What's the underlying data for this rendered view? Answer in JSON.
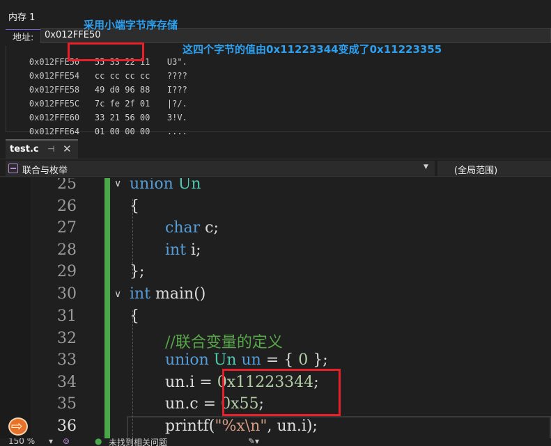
{
  "memory": {
    "title": "内存 1",
    "address_label": "地址:",
    "address_value": "0x012FFE50",
    "rows": [
      {
        "addr": "0x012FFE50",
        "hex": "55 33 22 11",
        "text": "U3\"."
      },
      {
        "addr": "0x012FFE54",
        "hex": "cc cc cc cc",
        "text": "????"
      },
      {
        "addr": "0x012FFE58",
        "hex": "49 d0 96 88",
        "text": "I???"
      },
      {
        "addr": "0x012FFE5C",
        "hex": "7c fe 2f 01",
        "text": "|?/."
      },
      {
        "addr": "0x012FFE60",
        "hex": "33 21 56 00",
        "text": "3!V."
      },
      {
        "addr": "0x012FFE64",
        "hex": "01 00 00 00",
        "text": "...."
      }
    ]
  },
  "annotations": {
    "little_endian": "采用小端字节序存储",
    "change_note": "这四个字节的值由0x11223344变成了0x11223355"
  },
  "editor": {
    "tab_name": "test.c",
    "pin_glyph": "⊣",
    "close_glyph": "✕",
    "scope_left": "联合与枚举",
    "scope_right": "(全局范围)",
    "line_numbers": [
      "25",
      "26",
      "27",
      "28",
      "29",
      "30",
      "31",
      "32",
      "33",
      "34",
      "35",
      "36"
    ],
    "code": {
      "l25_kw": "union",
      "l25_ty": "Un",
      "l26": "{",
      "l27_kw": "char",
      "l27_rest": " c;",
      "l28_kw": "int",
      "l28_rest": " i;",
      "l29": "};",
      "l30_kw": "int",
      "l30_rest": " main()",
      "l31": "{",
      "l32_cm": "//联合变量的定义",
      "l33_kw": "union",
      "l33_ty": " Un",
      "l33_var": " un",
      "l33_eq": " = { ",
      "l33_num": "0",
      "l33_end": " };",
      "l34_pre": "un.i = ",
      "l34_num": "0x11223344",
      "l34_end": ";",
      "l35_pre": "un.c = ",
      "l35_num": "0x55",
      "l35_end": ";",
      "l36_fn": "printf(",
      "l36_str": "\"%x\\n\"",
      "l36_end": ", un.i);"
    }
  },
  "status_bar": {
    "zoom": "150 %",
    "issues": "未找到相关问题"
  },
  "colors": {
    "accent": "#7160e8",
    "annotation": "#2ea0f0",
    "highlight_box": "#e8202a",
    "keyword": "#569cd6",
    "type": "#4ec9b0",
    "number": "#b5cea8",
    "comment": "#57a64a",
    "string": "#d69d85",
    "change_bar": "#4aa84a"
  }
}
